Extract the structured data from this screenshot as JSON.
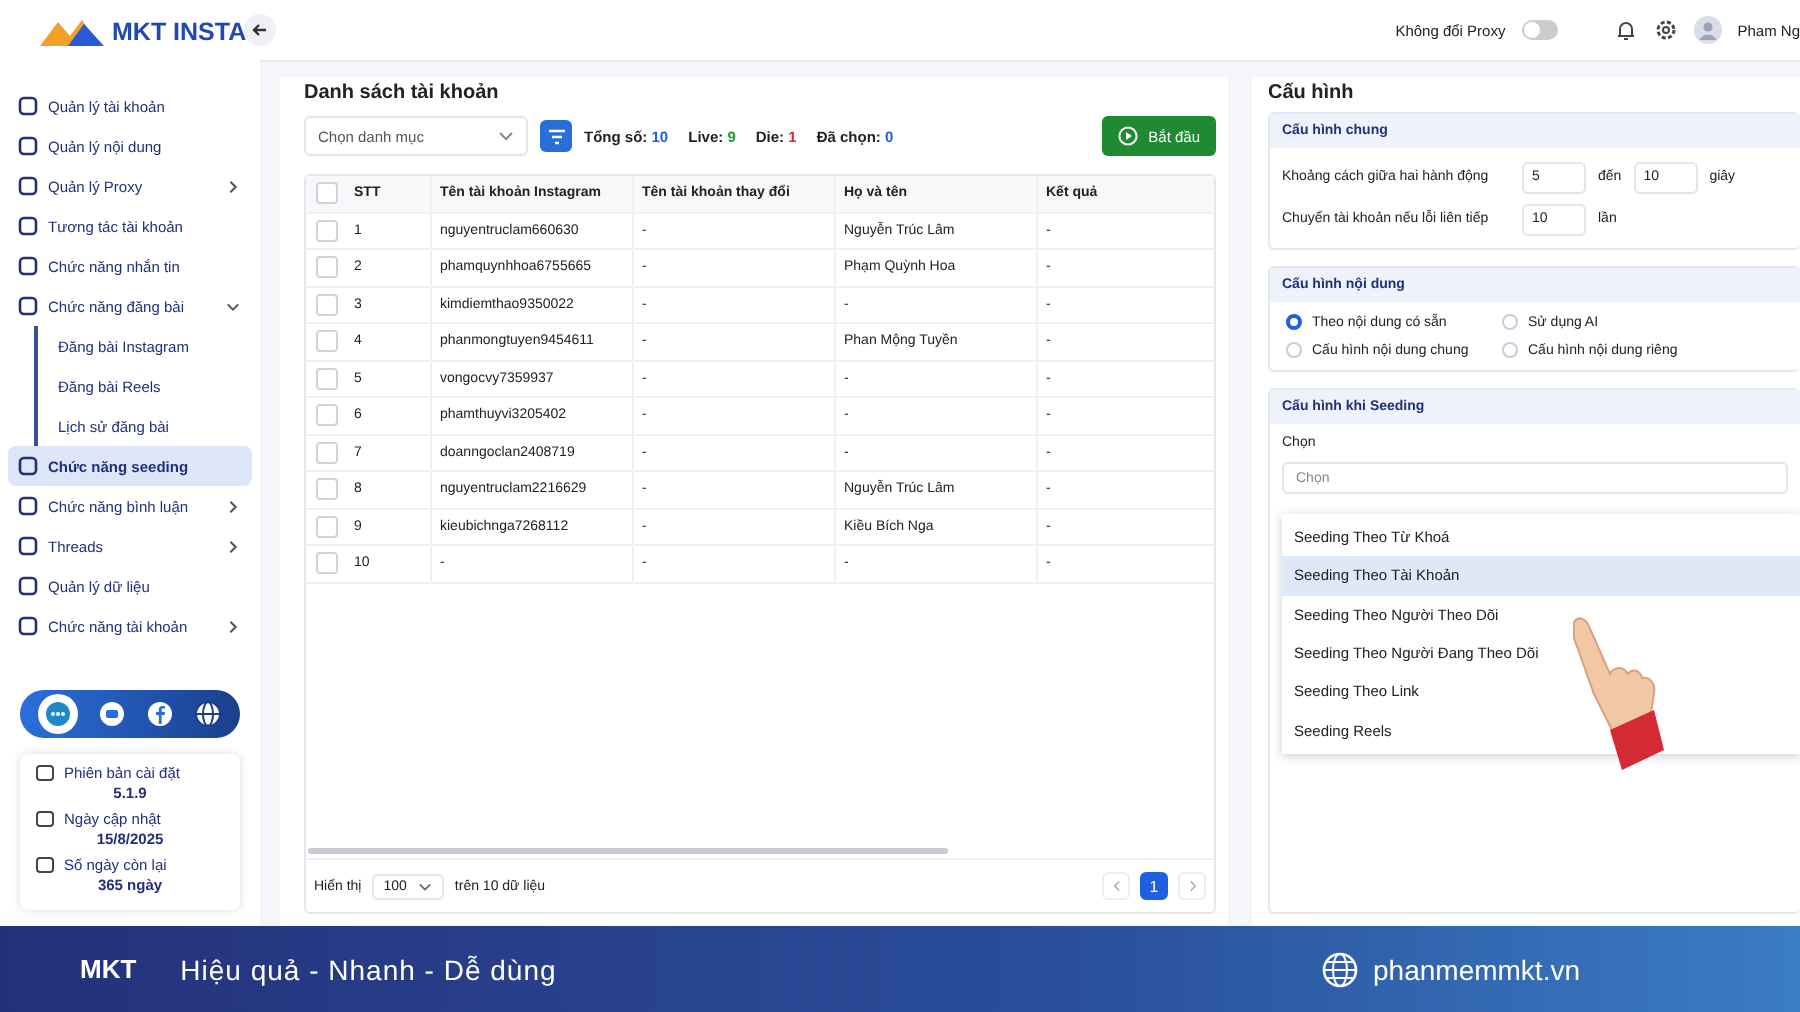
{
  "header": {
    "proxy_label": "Không đổi Proxy",
    "proxy_on": false,
    "user_name": "Pham Ng"
  },
  "sidebar": {
    "logo_text": "MKT INSTA",
    "items": [
      {
        "label": "Quản lý tài khoản",
        "kind": "link",
        "selected": false
      },
      {
        "label": "Quản lý nội dung",
        "kind": "link",
        "selected": false
      },
      {
        "label": "Quản lý Proxy",
        "kind": "group",
        "expanded": false,
        "selected": false
      },
      {
        "label": "Tương tác tài khoản",
        "kind": "link",
        "selected": false
      },
      {
        "label": "Chức năng nhắn tin",
        "kind": "link",
        "selected": false
      },
      {
        "label": "Chức năng đăng bài",
        "kind": "group",
        "expanded": true,
        "selected": false,
        "children": [
          {
            "label": "Đăng bài Instagram",
            "selected": false
          },
          {
            "label": "Đăng bài Reels",
            "selected": false
          },
          {
            "label": "Lịch sử đăng bài",
            "selected": false
          }
        ]
      },
      {
        "label": "Chức năng seeding",
        "kind": "link",
        "selected": true
      },
      {
        "label": "Chức năng bình luận",
        "kind": "group",
        "expanded": false,
        "selected": false
      },
      {
        "label": "Threads",
        "kind": "group",
        "expanded": false,
        "selected": false
      },
      {
        "label": "Quản lý dữ liệu",
        "kind": "link",
        "selected": false
      },
      {
        "label": "Chức năng tài khoản",
        "kind": "group",
        "expanded": false,
        "selected": false
      }
    ],
    "info": [
      {
        "label": "Phiên bản cài đặt",
        "value": "5.1.9"
      },
      {
        "label": "Ngày cập nhật",
        "value": "15/8/2025"
      },
      {
        "label": "Số ngày còn lại",
        "value": "365 ngày"
      }
    ]
  },
  "accounts": {
    "title": "Danh sách tài khoản",
    "category_placeholder": "Chọn danh mục",
    "stats": [
      {
        "label": "Tổng số:",
        "value": "10",
        "color": "#1f5fe0"
      },
      {
        "label": "Live:",
        "value": "9",
        "color": "#1f9d3a"
      },
      {
        "label": "Die:",
        "value": "1",
        "color": "#d92b2b"
      },
      {
        "label": "Đã chọn:",
        "value": "0",
        "color": "#1f5fe0"
      }
    ],
    "start_button": "Bắt đầu",
    "select_all_checked": false,
    "columns": [
      "STT",
      "Tên tài khoản Instagram",
      "Tên tài khoản thay đổi",
      "Họ và tên",
      "Kết quả"
    ],
    "rows": [
      {
        "checked": false,
        "cells": [
          "1",
          "nguyentruclam660630",
          "-",
          "Nguyễn Trúc Lâm",
          "-"
        ]
      },
      {
        "checked": false,
        "cells": [
          "2",
          "phamquynhhoa6755665",
          "-",
          "Phạm Quỳnh Hoa",
          "-"
        ]
      },
      {
        "checked": false,
        "cells": [
          "3",
          "kimdiemthao9350022",
          "-",
          "-",
          "-"
        ]
      },
      {
        "checked": false,
        "cells": [
          "4",
          "phanmongtuyen9454611",
          "-",
          "Phan Mộng Tuyền",
          "-"
        ]
      },
      {
        "checked": false,
        "cells": [
          "5",
          "vongocvy7359937",
          "-",
          "-",
          "-"
        ]
      },
      {
        "checked": false,
        "cells": [
          "6",
          "phamthuyvi3205402",
          "-",
          "-",
          "-"
        ]
      },
      {
        "checked": false,
        "cells": [
          "7",
          "doanngoclan2408719",
          "-",
          "-",
          "-"
        ]
      },
      {
        "checked": false,
        "cells": [
          "8",
          "nguyentruclam2216629",
          "-",
          "Nguyễn Trúc Lâm",
          "-"
        ]
      },
      {
        "checked": false,
        "cells": [
          "9",
          "kieubichnga7268112",
          "-",
          "Kiều Bích Nga",
          "-"
        ]
      },
      {
        "checked": false,
        "cells": [
          "10",
          "-",
          "-",
          "-",
          "-"
        ]
      }
    ],
    "show_label": "Hiển thị",
    "page_size": "100",
    "total_text": "trên 10 dữ liệu",
    "pages": [
      {
        "label": "1",
        "selected": true
      }
    ]
  },
  "config": {
    "title": "Cấu hình",
    "general": {
      "title": "Cấu hình chung",
      "gap_label": "Khoảng cách giữa hai hành động",
      "gap_from": "5",
      "gap_to_label": "đến",
      "gap_to": "10",
      "gap_unit": "giây",
      "switch_label": "Chuyển tài khoản nếu lỗi liên tiếp",
      "switch_value": "10",
      "switch_unit": "lần"
    },
    "content": {
      "title": "Cấu hình nội dung",
      "options": [
        {
          "label": "Theo nội dung có sẵn",
          "selected": true
        },
        {
          "label": "Sử dụng AI",
          "selected": false
        },
        {
          "label": "Cấu hình nội dung chung",
          "selected": false
        },
        {
          "label": "Cấu hình nội dung riêng",
          "selected": false
        }
      ]
    },
    "seeding": {
      "title": "Cấu hình khi Seeding",
      "field_label": "Chọn",
      "placeholder": "Chọn",
      "options": [
        {
          "label": "Seeding Theo Từ Khoá",
          "selected": false
        },
        {
          "label": "Seeding Theo Tài Khoản",
          "selected": true
        },
        {
          "label": "Seeding Theo Người Theo Dõi",
          "selected": false
        },
        {
          "label": "Seeding Theo Người Đang Theo Dõi",
          "selected": false
        },
        {
          "label": "Seeding Theo Link",
          "selected": false
        },
        {
          "label": "Seeding Reels",
          "selected": false
        }
      ]
    }
  },
  "banner": {
    "logo_text": "MKT",
    "slogan": "Hiệu quả - Nhanh - Dễ dùng",
    "website": "phanmemmkt.vn"
  }
}
